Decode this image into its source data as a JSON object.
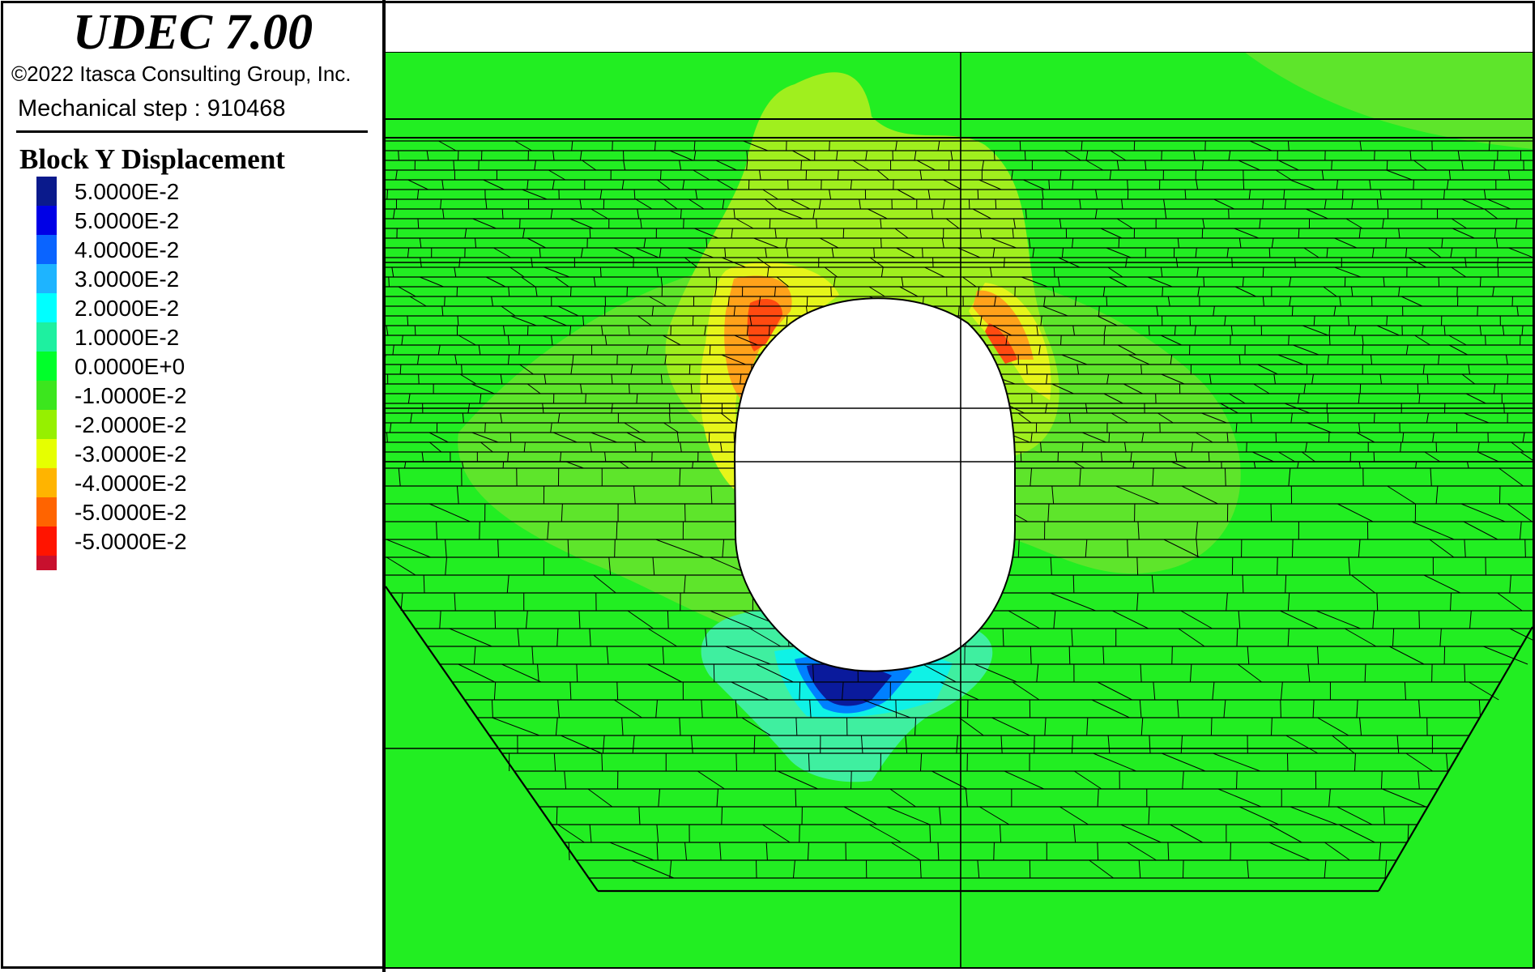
{
  "header": {
    "app_title": "UDEC 7.00",
    "copyright": "©2022 Itasca Consulting Group, Inc.",
    "step_label": "Mechanical step : ",
    "step_value": "910468"
  },
  "legend": {
    "title": "Block Y Displacement",
    "entries": [
      {
        "label": "5.0000E-2",
        "color": "#0a1a8c"
      },
      {
        "label": "5.0000E-2",
        "color": "#0000e6"
      },
      {
        "label": "4.0000E-2",
        "color": "#0a64ff"
      },
      {
        "label": "3.0000E-2",
        "color": "#1eb4ff"
      },
      {
        "label": "2.0000E-2",
        "color": "#00ffff"
      },
      {
        "label": "1.0000E-2",
        "color": "#1ef0a0"
      },
      {
        "label": "0.0000E+0",
        "color": "#00ff2a"
      },
      {
        "label": "-1.0000E-2",
        "color": "#3ce61e"
      },
      {
        "label": "-2.0000E-2",
        "color": "#96f000"
      },
      {
        "label": "-3.0000E-2",
        "color": "#e6ff00"
      },
      {
        "label": "-4.0000E-2",
        "color": "#ffb400"
      },
      {
        "label": "-5.0000E-2",
        "color": "#ff6400"
      },
      {
        "label": "-5.0000E-2",
        "color": "#ff1400"
      }
    ],
    "extra_bottom_color": "#c8102e"
  },
  "model": {
    "background_color": "#22ee22",
    "opening_color": "#ffffff",
    "joint_color": "#000000",
    "contour_colors": {
      "green_mid": "#5ee52b",
      "yellow_green": "#a0ef1e",
      "yellow": "#e6f51a",
      "orange": "#ffa21a",
      "red": "#ff4a10",
      "teal": "#3fefa0",
      "cyan": "#0ff2e6",
      "blue": "#0080ff",
      "dark_blue": "#0a1a9c"
    }
  }
}
